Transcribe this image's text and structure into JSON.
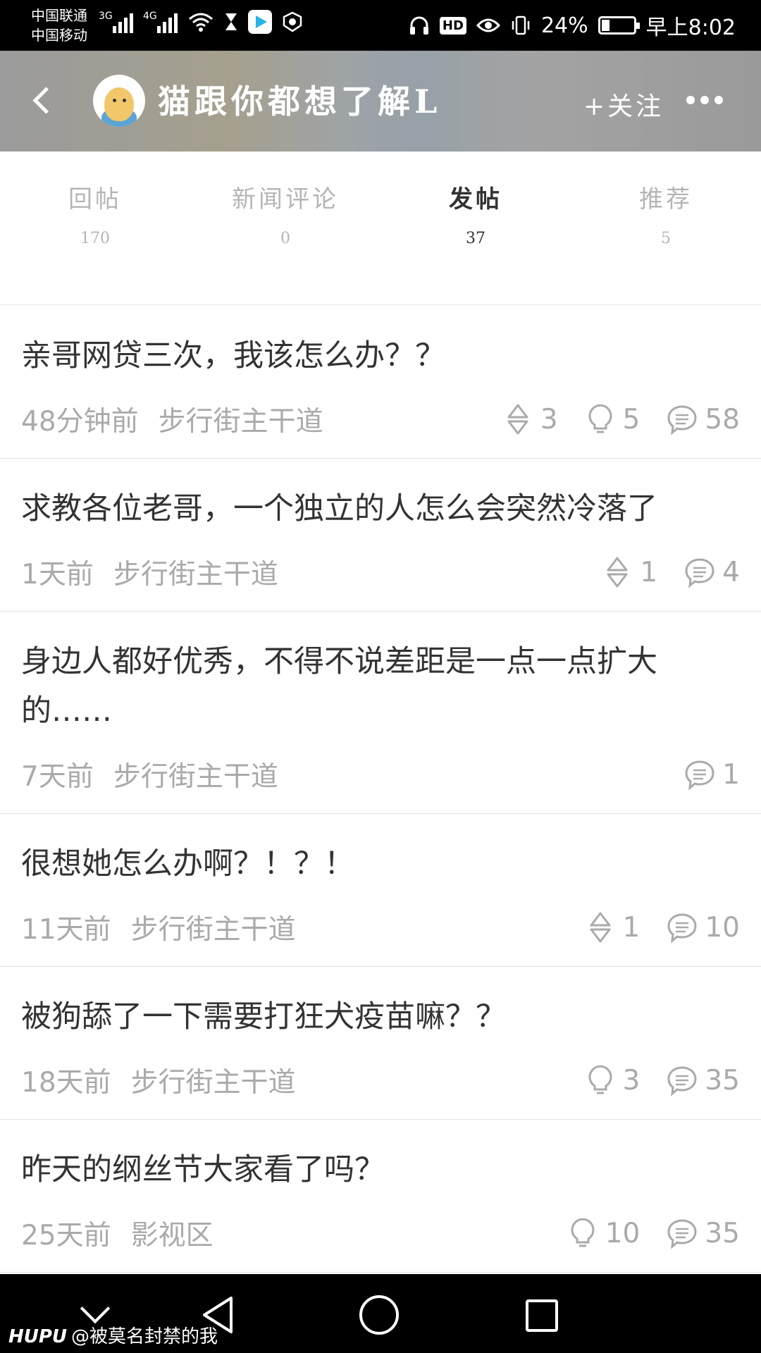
{
  "status_bar": {
    "carrier_1": "中国联通",
    "carrier_2": "中国移动",
    "network_1": "3G",
    "network_2": "4G",
    "battery_percent": "24%",
    "battery_level": 0.24,
    "time": "早上8:02",
    "hd_label": "HD"
  },
  "header": {
    "username": "猫跟你都想了解L",
    "follow_label": "+关注"
  },
  "tabs": [
    {
      "label": "回帖",
      "count": "170"
    },
    {
      "label": "新闻评论",
      "count": "0"
    },
    {
      "label": "发帖",
      "count": "37",
      "active": true
    },
    {
      "label": "推荐",
      "count": "5"
    }
  ],
  "posts": [
    {
      "title": "亲哥网贷三次，我该怎么办？？",
      "time": "48分钟前",
      "forum": "步行街主干道",
      "recommend": "3",
      "light": "5",
      "replies": "58"
    },
    {
      "title": "求教各位老哥，一个独立的人怎么会突然冷落了",
      "time": "1天前",
      "forum": "步行街主干道",
      "recommend": "1",
      "replies": "4"
    },
    {
      "title": "身边人都好优秀，不得不说差距是一点一点扩大的……",
      "time": "7天前",
      "forum": "步行街主干道",
      "replies": "1"
    },
    {
      "title": "很想她怎么办啊？！？！",
      "time": "11天前",
      "forum": "步行街主干道",
      "recommend": "1",
      "replies": "10"
    },
    {
      "title": "被狗舔了一下需要打狂犬疫苗嘛？？",
      "time": "18天前",
      "forum": "步行街主干道",
      "light": "3",
      "replies": "35"
    },
    {
      "title": "昨天的纲丝节大家看了吗？",
      "time": "25天前",
      "forum": "影视区",
      "light": "10",
      "replies": "35"
    }
  ],
  "watermark": {
    "brand": "HUPU",
    "handle": "@被莫名封禁的我"
  },
  "icons": {
    "recommend": "recommend-arrows-icon",
    "light": "lightbulb-icon",
    "reply": "comment-bubble-icon"
  },
  "colors": {
    "meta_text": "#aaaaaa",
    "title_text": "#333333",
    "active_tab": "#333333",
    "inactive_tab": "#b5b5b5"
  }
}
